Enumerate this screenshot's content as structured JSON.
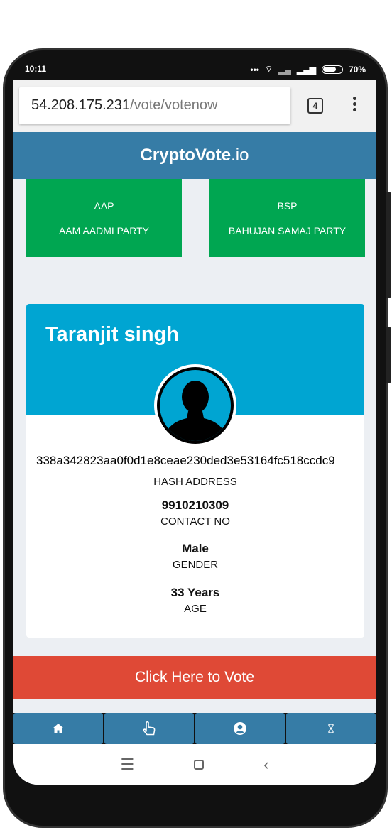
{
  "status_bar": {
    "time": "10:11",
    "battery": "70%"
  },
  "browser": {
    "url_host": "54.208.175.231",
    "url_path": "/vote/votenow",
    "tab_count": "4"
  },
  "app": {
    "brand_bold": "CryptoVote",
    "brand_suffix": ".io"
  },
  "parties": [
    {
      "abbr": "AAP",
      "name": "AAM AADMI PARTY"
    },
    {
      "abbr": "BSP",
      "name": "BAHUJAN SAMAJ PARTY"
    }
  ],
  "voter": {
    "name": "Taranjit singh",
    "hash": "338a342823aa0f0d1e8ceae230ded3e53164fc518ccdc9",
    "hash_label": "HASH ADDRESS",
    "contact": "9910210309",
    "contact_label": "CONTACT NO",
    "gender": "Male",
    "gender_label": "GENDER",
    "age": "33 Years",
    "age_label": "AGE"
  },
  "vote_button": "Click Here to Vote",
  "bottom_nav": [
    {
      "icon": "home-icon"
    },
    {
      "icon": "hand-pointer-icon"
    },
    {
      "icon": "user-circle-icon"
    },
    {
      "icon": "hourglass-icon"
    }
  ],
  "colors": {
    "header": "#367ca6",
    "party": "#00a651",
    "card_header": "#00a5d2",
    "vote": "#df4936"
  }
}
